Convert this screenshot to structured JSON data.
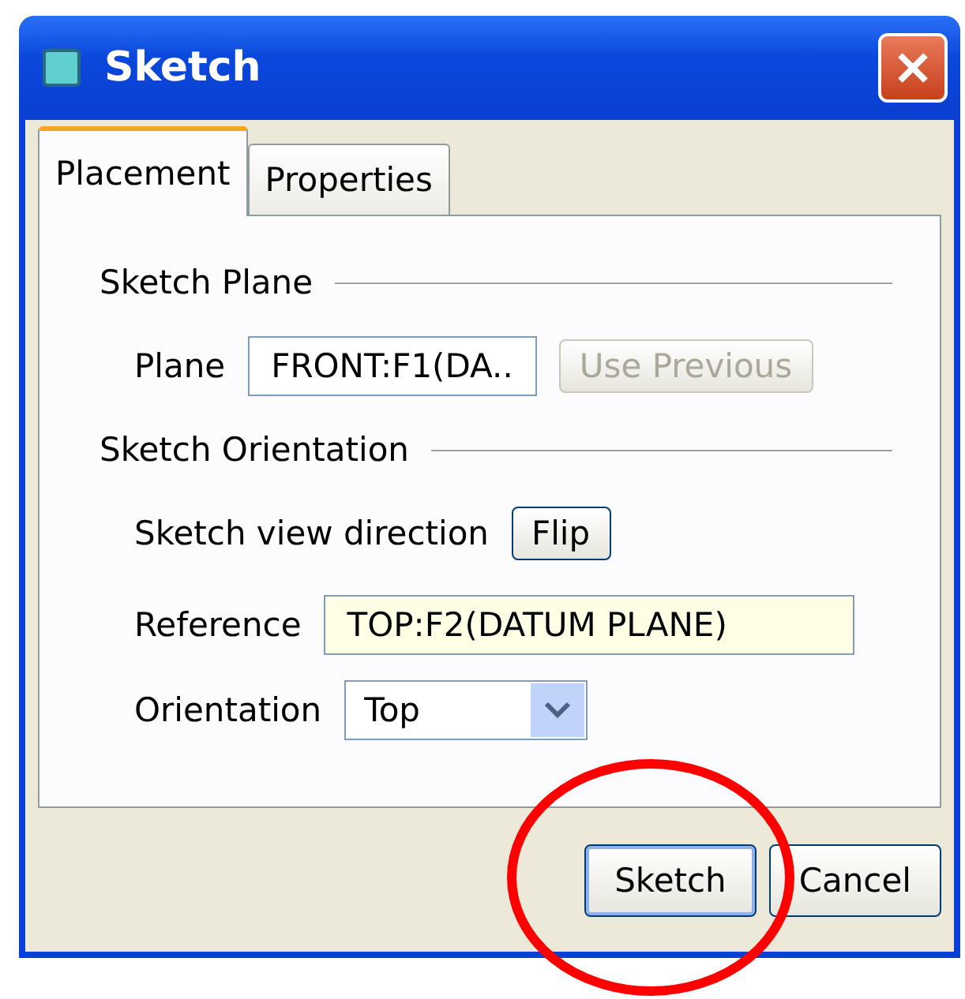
{
  "window": {
    "title": "Sketch"
  },
  "tabs": [
    {
      "label": "Placement",
      "selected": true
    },
    {
      "label": "Properties",
      "selected": false
    }
  ],
  "sketch_plane": {
    "heading": "Sketch Plane",
    "plane": {
      "label": "Plane",
      "value": "FRONT:F1(DA.."
    },
    "use_previous": {
      "label": "Use Previous",
      "disabled": true
    }
  },
  "sketch_orientation": {
    "heading": "Sketch Orientation",
    "view_direction": {
      "label": "Sketch view direction",
      "button": "Flip"
    },
    "reference": {
      "label": "Reference",
      "value": "TOP:F2(DATUM PLANE)"
    },
    "orientation": {
      "label": "Orientation",
      "value": "Top"
    }
  },
  "buttons": [
    {
      "label": "Sketch",
      "default": true
    },
    {
      "label": "Cancel",
      "default": false
    }
  ],
  "annotation": {
    "kind": "circle"
  }
}
